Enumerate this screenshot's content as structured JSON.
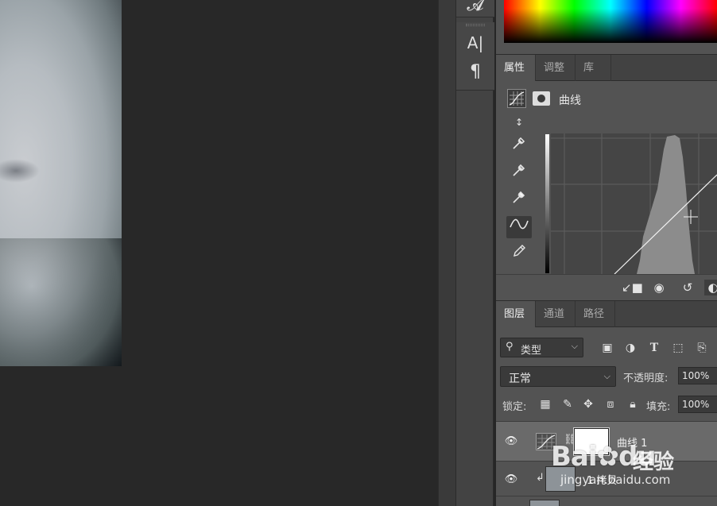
{
  "tools": {
    "items": [
      {
        "name": "vertical-type-tool",
        "glyph": "𝓐"
      },
      {
        "name": "character-panel",
        "glyph": "A|"
      },
      {
        "name": "paragraph-panel",
        "glyph": "¶"
      }
    ]
  },
  "properties": {
    "tabs": [
      "属性",
      "调整",
      "库"
    ],
    "active_tab": "属性",
    "title": "曲线"
  },
  "layers": {
    "tabs": [
      "图层",
      "通道",
      "路径"
    ],
    "active_tab": "图层",
    "filter_label": "类型",
    "blend_mode": "正常",
    "opacity_label": "不透明度:",
    "opacity_value": "100%",
    "lock_label": "锁定:",
    "fill_label": "填充:",
    "fill_value": "100%",
    "rows": [
      {
        "name": "曲线 1"
      },
      {
        "name": "1 拷贝"
      }
    ]
  },
  "watermark": {
    "logo": "Bai",
    "logo_suffix": "du",
    "jingyan": "经验",
    "url": "jingyan.baidu.com"
  }
}
